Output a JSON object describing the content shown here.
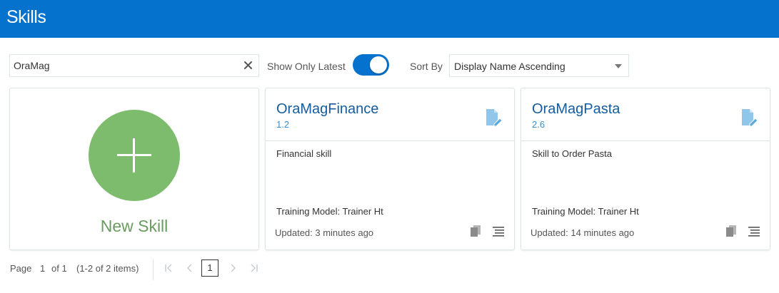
{
  "header": {
    "title": "Skills"
  },
  "toolbar": {
    "search_value": "OraMag",
    "show_only_latest_label": "Show Only Latest",
    "show_only_latest_on": true,
    "sort_label": "Sort By",
    "sort_value": "Display Name Ascending"
  },
  "new_skill": {
    "label": "New Skill"
  },
  "skills": [
    {
      "name": "OraMagFinance",
      "version": "1.2",
      "description": "Financial skill",
      "training_model": "Training Model: Trainer Ht",
      "updated": "Updated: 3 minutes ago"
    },
    {
      "name": "OraMagPasta",
      "version": "2.6",
      "description": "Skill to Order Pasta",
      "training_model": "Training Model: Trainer Ht",
      "updated": "Updated: 14 minutes ago"
    }
  ],
  "pagination": {
    "page_label": "Page",
    "page": "1",
    "of_label": "of 1",
    "items_label": "(1-2 of 2 items)",
    "current": "1",
    "icons": {
      "first": "first-page-icon",
      "prev": "prev-page-icon",
      "next": "next-page-icon",
      "last": "last-page-icon"
    }
  },
  "colors": {
    "accent": "#0572ce",
    "new_skill_green": "#7cbc6c",
    "skill_name": "#145c9e"
  }
}
